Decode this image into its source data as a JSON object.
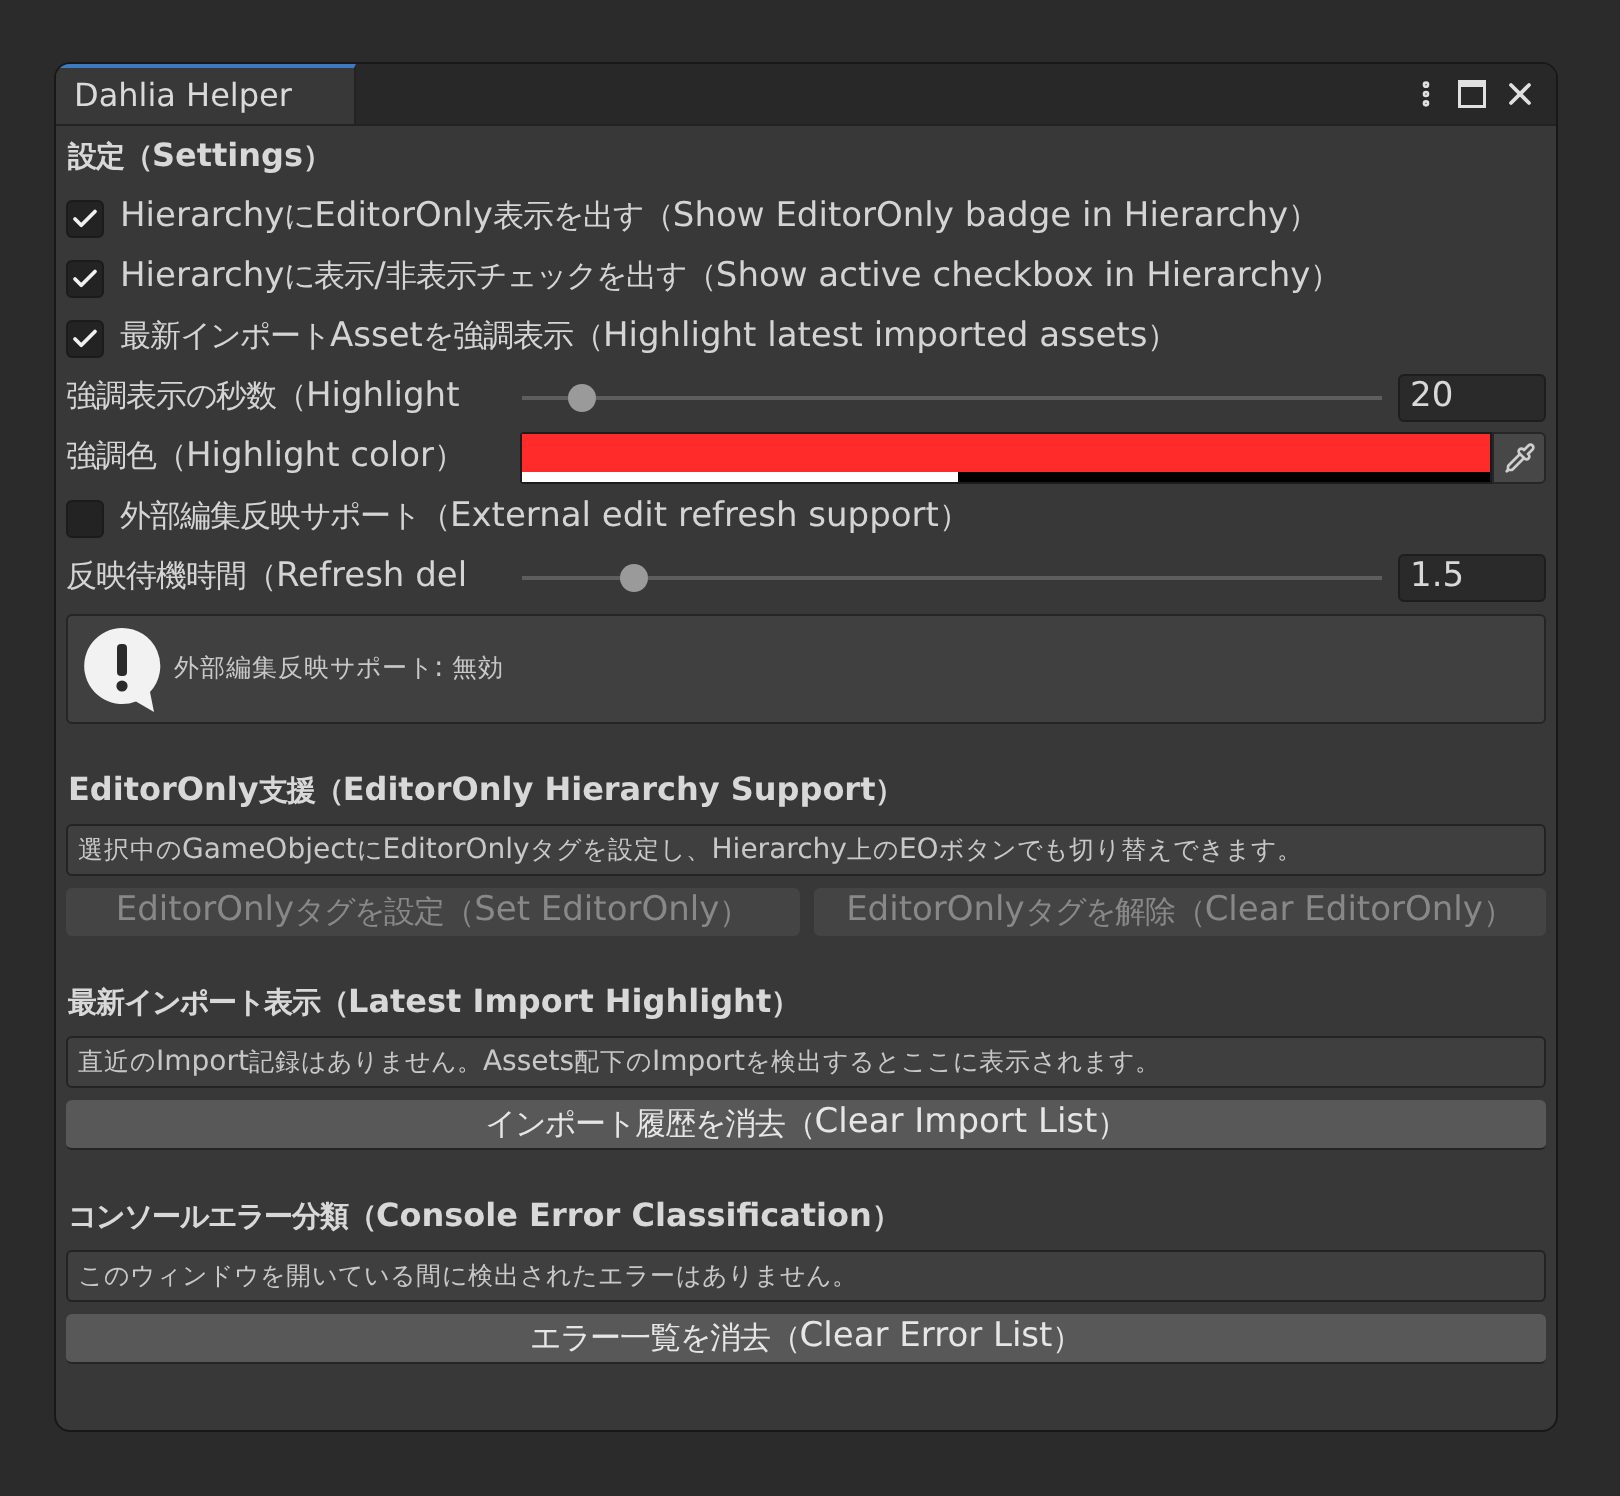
{
  "window": {
    "title": "Dahlia Helper"
  },
  "sections": [
    {
      "heading": "設定（Settings）",
      "items": [
        {
          "kind": "checkbox",
          "label": "HierarchyにEditorOnly表示を出す（Show EditorOnly badge in Hierarchy）",
          "checked": true
        },
        {
          "kind": "checkbox",
          "label": "Hierarchyに表示/非表示チェックを出す（Show active checkbox in Hierarchy）",
          "checked": true
        },
        {
          "kind": "checkbox",
          "label": "最新インポートAssetを強調表示（Highlight latest imported assets）",
          "checked": true
        },
        {
          "kind": "slider",
          "label": "強調表示の秒数（Highlight",
          "level": 0.07,
          "value": "20"
        },
        {
          "kind": "color",
          "label": "強調色（Highlight color）",
          "color": "#ff2a2a",
          "level": 0.45
        },
        {
          "kind": "checkbox",
          "label": "外部編集反映サポート（External edit refresh support）",
          "checked": false
        },
        {
          "kind": "slider",
          "label": "反映待機時間（Refresh del",
          "level": 0.13,
          "value": "1.5"
        },
        {
          "kind": "help",
          "text": "外部編集反映サポート: 無効"
        }
      ]
    },
    {
      "heading": "EditorOnly支援（EditorOnly Hierarchy Support）",
      "items": [
        {
          "kind": "info",
          "text": "選択中のGameObjectにEditorOnlyタグを設定し、Hierarchy上のEOボタンでも切り替えできます。"
        },
        {
          "kind": "buttons",
          "buttons": [
            {
              "label": "EditorOnlyタグを設定（Set EditorOnly）",
              "disabled": true
            },
            {
              "label": "EditorOnlyタグを解除（Clear EditorOnly）",
              "disabled": true
            }
          ]
        }
      ]
    },
    {
      "heading": "最新インポート表示（Latest Import Highlight）",
      "items": [
        {
          "kind": "info",
          "text": "直近のImport記録はありません。Assets配下のImportを検出するとここに表示されます。"
        },
        {
          "kind": "buttons",
          "buttons": [
            {
              "label": "インポート履歴を消去（Clear Import List）",
              "disabled": false
            }
          ]
        }
      ]
    },
    {
      "heading": "コンソールエラー分類（Console Error Classification）",
      "items": [
        {
          "kind": "info",
          "text": "このウィンドウを開いている間に検出されたエラーはありません。"
        },
        {
          "kind": "buttons",
          "buttons": [
            {
              "label": "エラー一覧を消去（Clear Error List）",
              "disabled": false
            }
          ]
        }
      ]
    }
  ]
}
